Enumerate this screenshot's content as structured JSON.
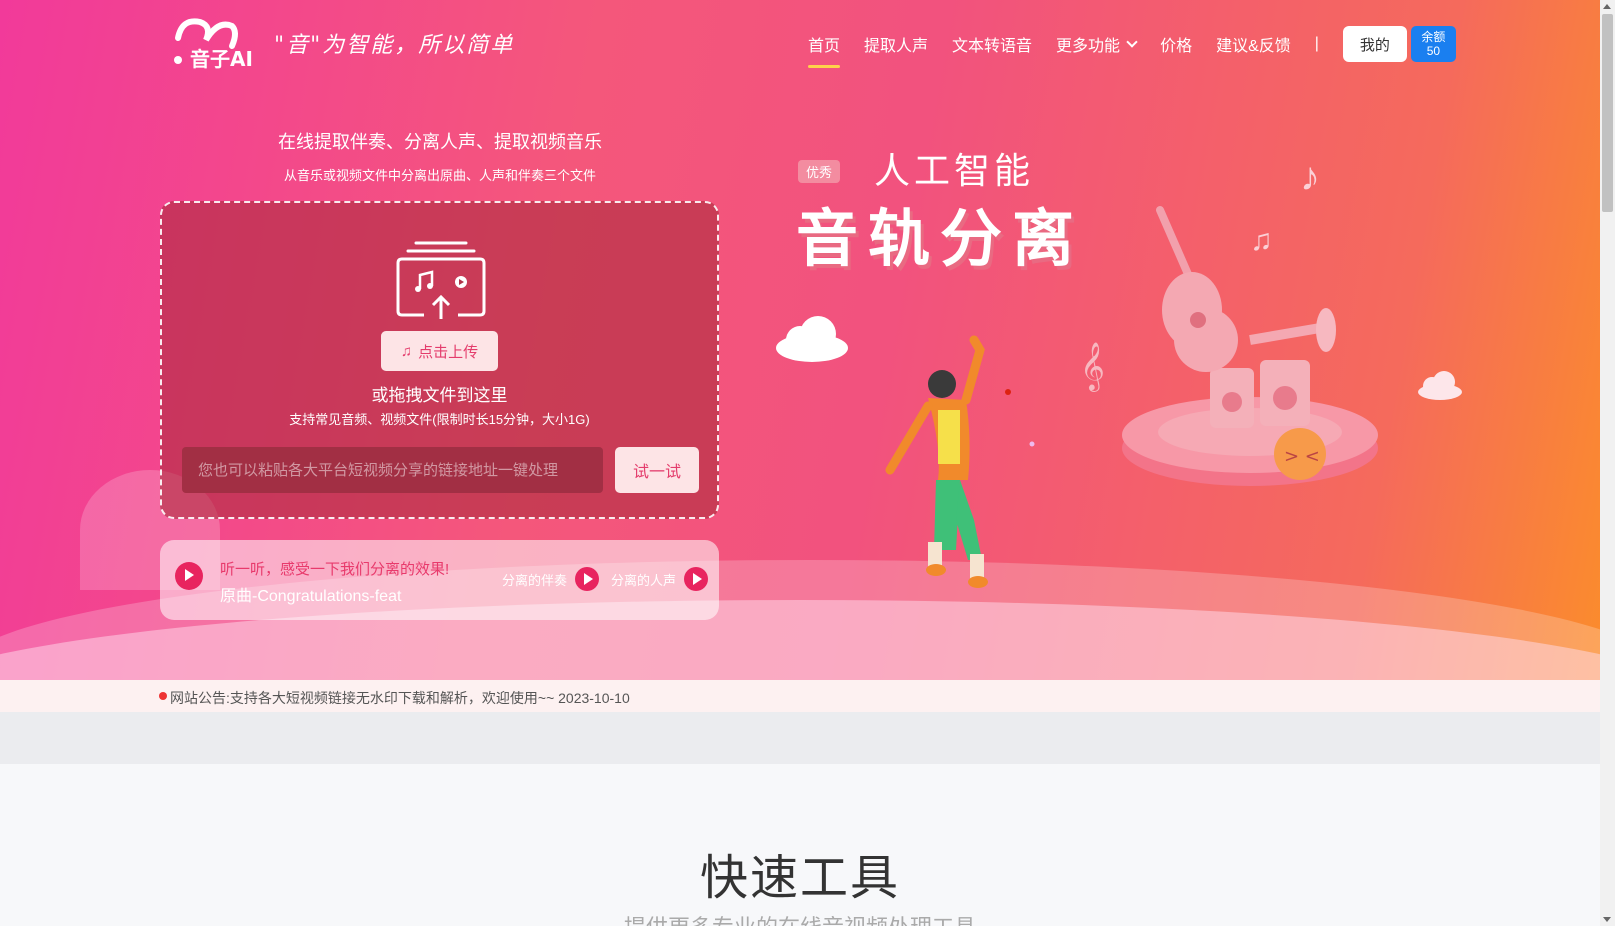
{
  "header": {
    "logo_text": "音子AI",
    "slogan": "\"音\"为智能，所以简单",
    "nav": [
      {
        "label": "首页",
        "active": true
      },
      {
        "label": "提取人声"
      },
      {
        "label": "文本转语音"
      },
      {
        "label": "更多功能"
      },
      {
        "label": "价格"
      },
      {
        "label": "建议&反馈"
      }
    ],
    "divider": "|",
    "mine_button": "我的",
    "balance_label": "余额",
    "balance_value": "50"
  },
  "upload": {
    "title": "在线提取伴奏、分离人声、提取视频音乐",
    "subtitle": "从音乐或视频文件中分离出原曲、人声和伴奏三个文件",
    "upload_button": "点击上传",
    "drag_text": "或拖拽文件到这里",
    "hint": "支持常见音频、视频文件(限制时长15分钟，大小1G)",
    "link_placeholder": "您也可以粘贴各大平台短视频分享的链接地址一键处理",
    "try_button": "试一试"
  },
  "demo": {
    "prompt": "听一听，感受一下我们分离的效果!",
    "track": "原曲-Congratulations-feat",
    "accompaniment_label": "分离的伴奏",
    "vocal_label": "分离的人声"
  },
  "illustration": {
    "badge": "优秀",
    "ai_text": "人工智能",
    "headline": "音轨分离"
  },
  "announcement": {
    "text": "网站公告:支持各大短视频链接无水印下载和解析，欢迎使用~~ 2023-10-10"
  },
  "quick_tools": {
    "title": "快速工具",
    "subtitle": "提供更多专业的在线音视频处理工具"
  },
  "colors": {
    "accent": "#e8245f",
    "balance": "#1a7ff0",
    "active_underline": "#ffd24a"
  }
}
